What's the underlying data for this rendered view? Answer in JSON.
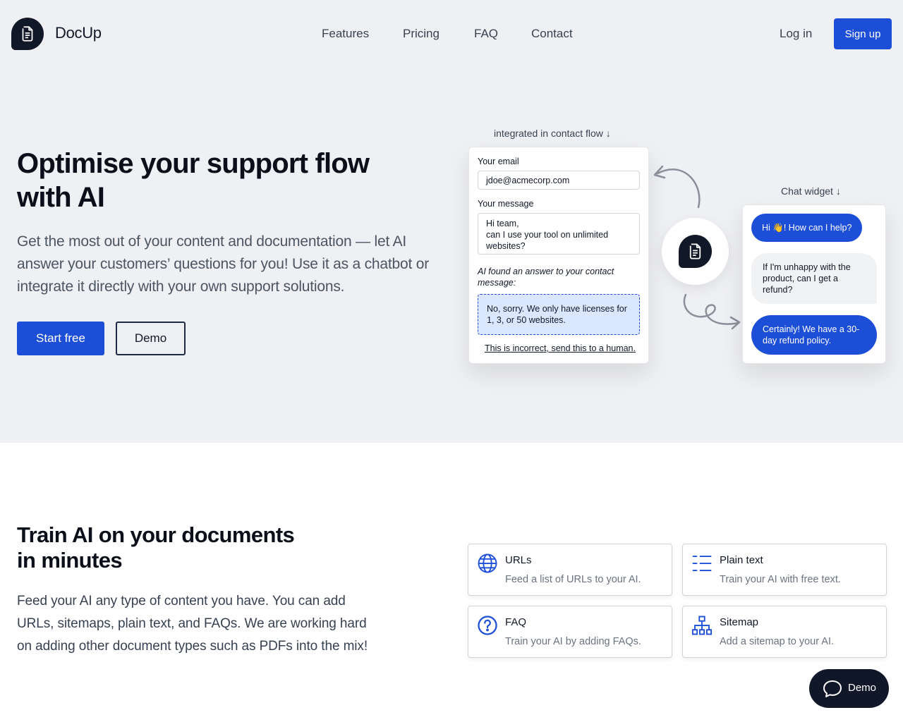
{
  "header": {
    "brand": "DocUp",
    "nav": [
      "Features",
      "Pricing",
      "FAQ",
      "Contact"
    ],
    "login": "Log in",
    "signup": "Sign up"
  },
  "hero": {
    "title_line1": "Optimise your support flow",
    "title_line2": "with AI",
    "description": "Get the most out of your content and documentation — let AI answer your customers’ questions for you! Use it as a chatbot or integrate it directly with your own support solutions.",
    "cta_primary": "Start free",
    "cta_secondary": "Demo"
  },
  "contact_flow": {
    "caption": "integrated in contact flow ↓",
    "email_label": "Your email",
    "email_value": "jdoe@acmecorp.com",
    "message_label": "Your message",
    "message_line1": "Hi team,",
    "message_line2": "can I use your tool on unlimited",
    "message_line3": "websites?",
    "ai_note": "AI found an answer to your contact message:",
    "ai_answer": "No, sorry. We only have licenses for 1, 3, or 50 websites.",
    "escalate_link": "This is incorrect, send this to a human."
  },
  "chat_widget": {
    "caption": "Chat widget ↓",
    "bot_greeting": "Hi 👋! How can I help?",
    "user_message": "If I'm unhappy with the product, can I get a refund?",
    "bot_answer": "Certainly! We have a 30-day refund policy."
  },
  "training": {
    "title_line1": "Train AI on your documents",
    "title_line2": "in minutes",
    "description": "Feed your AI any type of content you have. You can add URLs, sitemaps, plain text, and FAQs. We are working hard on adding other document types such as PDFs into the mix!",
    "sources": [
      {
        "title": "URLs",
        "desc": "Feed a list of URLs to your AI.",
        "icon": "globe-icon"
      },
      {
        "title": "Plain text",
        "desc": "Train your AI with free text.",
        "icon": "list-icon"
      },
      {
        "title": "FAQ",
        "desc": "Train your AI by adding FAQs.",
        "icon": "question-icon"
      },
      {
        "title": "Sitemap",
        "desc": "Add a sitemap to your AI.",
        "icon": "sitemap-icon"
      }
    ]
  },
  "floating": {
    "demo": "Demo"
  },
  "colors": {
    "accent": "#1d4ed8",
    "dark": "#0f1729",
    "hero_bg": "#eff0f3",
    "answer_bg": "#dbe7fe"
  }
}
